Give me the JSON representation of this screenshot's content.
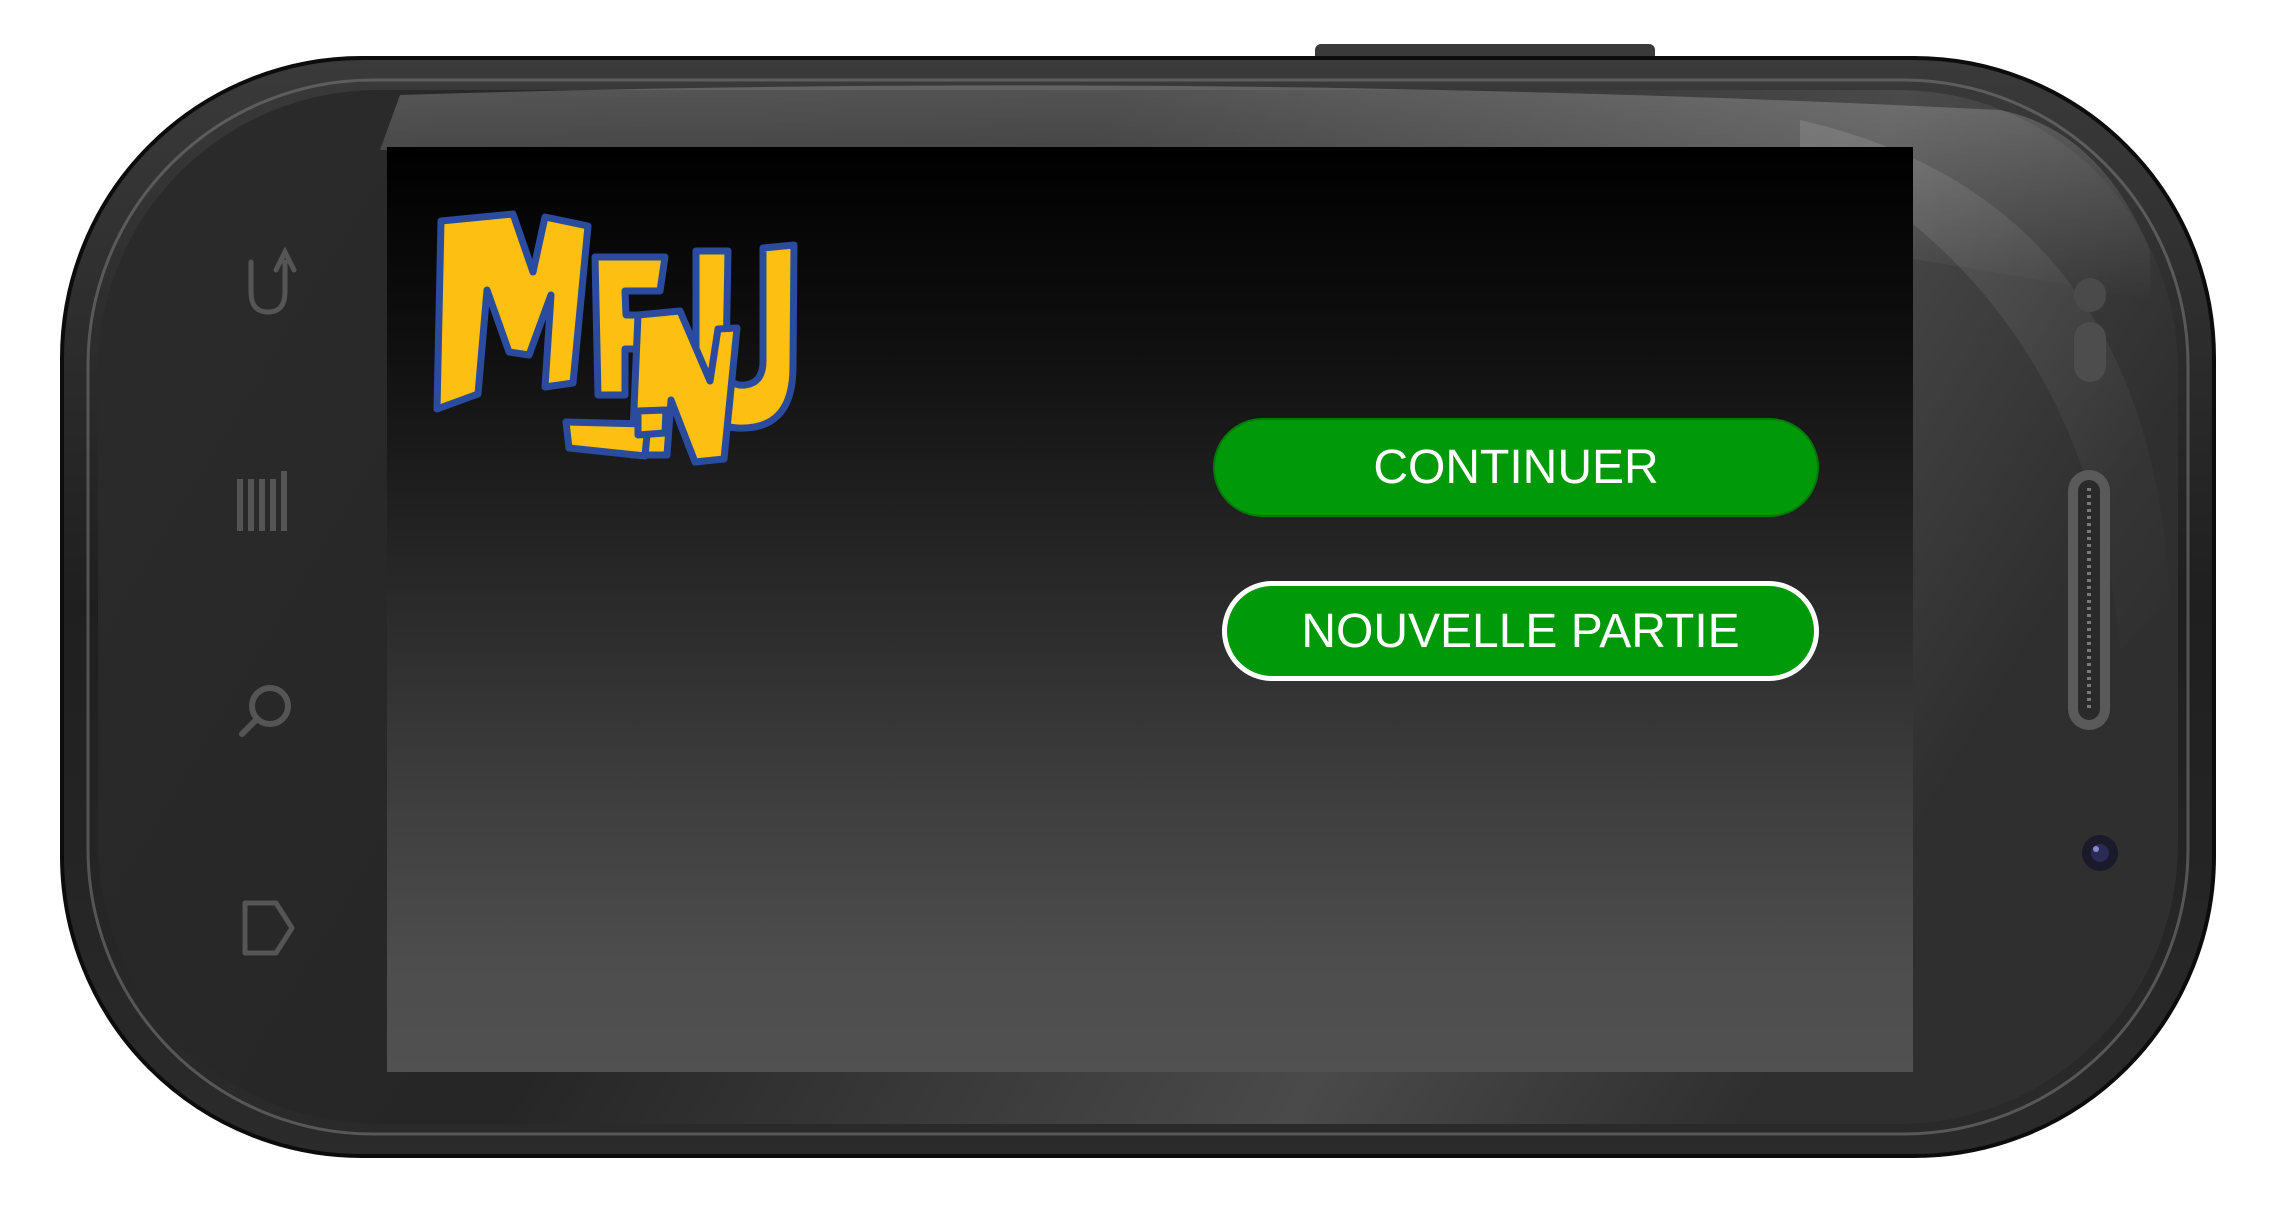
{
  "app": {
    "logo_text": "MENU"
  },
  "menu": {
    "continue_label": "CONTINUER",
    "new_game_label": "NOUVELLE PARTIE"
  },
  "device": {
    "soft_keys": [
      "back-icon",
      "menu-icon",
      "search-icon",
      "home-icon"
    ],
    "speaker": "speaker-grille",
    "camera": "front-camera"
  },
  "colors": {
    "button_green": "#00990a",
    "logo_yellow": "#fcbf12",
    "logo_outline": "#2b4b9e",
    "screen_top": "#000000",
    "screen_bottom": "#515151"
  }
}
